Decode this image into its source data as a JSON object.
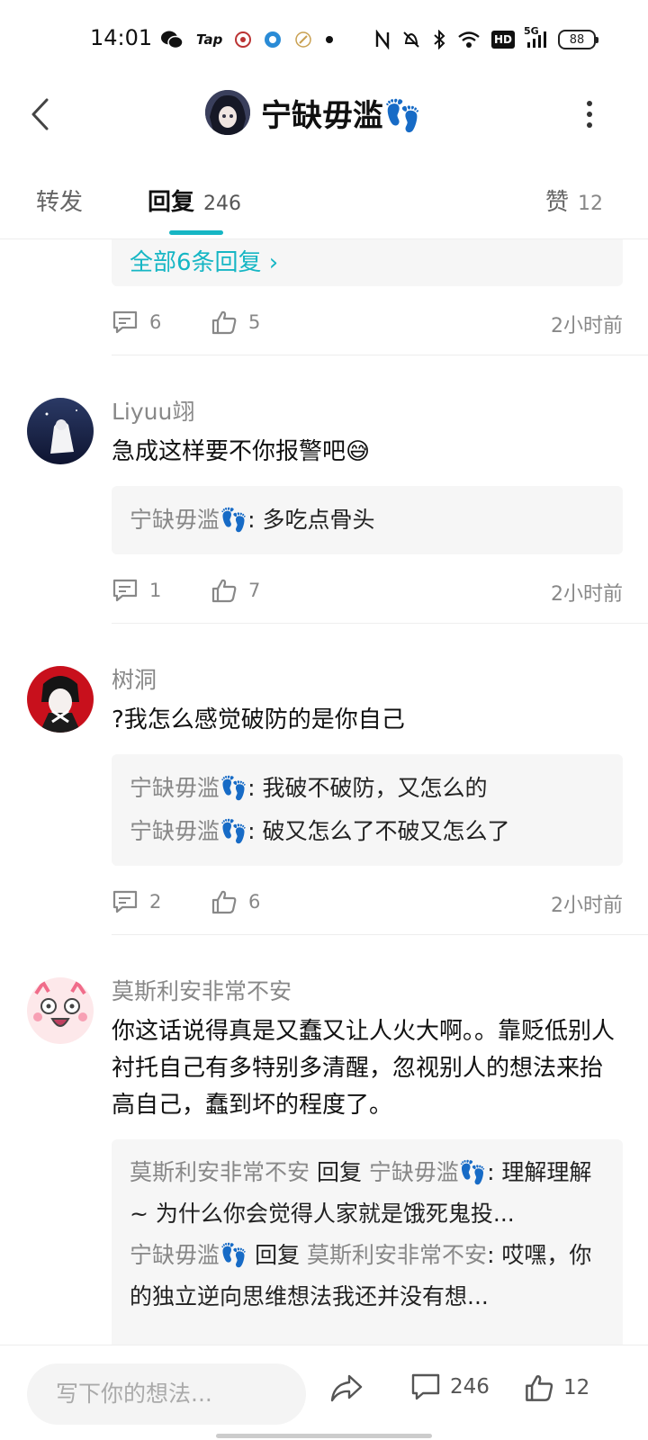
{
  "status_bar": {
    "time": "14:01",
    "icons_left": [
      "wechat-icon",
      "taptap-icon",
      "app-icon",
      "app-icon",
      "app-icon",
      "dot-icon"
    ],
    "tap_label": "Tap",
    "icons_right": [
      "nfc-icon",
      "mute-icon",
      "bluetooth-icon",
      "wifi-icon",
      "hd-icon",
      "signal-5g-icon"
    ],
    "hd_label": "HD",
    "network_label": "5G",
    "battery": "88"
  },
  "header": {
    "title": "宁缺毋滥👣"
  },
  "tabs": [
    {
      "label": "转发",
      "count": ""
    },
    {
      "label": "回复",
      "count": "246"
    },
    {
      "label": "赞",
      "count": "12"
    }
  ],
  "thread_top": {
    "all_replies": "全部6条回复 ›",
    "reply_count": "6",
    "like_count": "5",
    "time": "2小时前"
  },
  "comments": [
    {
      "username": "Liyuu翊",
      "text": "急成这样要不你报警吧😅",
      "replies": [
        {
          "user": "宁缺毋滥👣",
          "text": ": 多吃点骨头"
        }
      ],
      "reply_count": "1",
      "like_count": "7",
      "time": "2小时前"
    },
    {
      "username": "树洞",
      "text": "?我怎么感觉破防的是你自己",
      "replies": [
        {
          "user": "宁缺毋滥👣",
          "text": ": 我破不破防，又怎么的"
        },
        {
          "user": "宁缺毋滥👣",
          "text": ": 破又怎么了不破又怎么了"
        }
      ],
      "reply_count": "2",
      "like_count": "6",
      "time": "2小时前"
    },
    {
      "username": "莫斯利安非常不安",
      "text": "你这话说得真是又蠢又让人火大啊。。靠贬低别人衬托自己有多特别多清醒，忽视别人的想法来抬高自己，蠢到坏的程度了。",
      "replies": [
        {
          "user": "莫斯利安非常不安",
          "mid": " 回复 ",
          "target": "宁缺毋滥👣",
          "text": ": 理解理解 ~ 为什么你会觉得人家就是饿死鬼投..."
        },
        {
          "user": "宁缺毋滥👣",
          "mid": " 回复 ",
          "target": "莫斯利安非常不安",
          "text": ": 哎嘿，你的独立逆向思维想法我还并没有想..."
        }
      ]
    }
  ],
  "bottom_bar": {
    "input_placeholder": "写下你的想法...",
    "comment_count": "246",
    "like_count": "12"
  },
  "colors": {
    "accent": "#16b6c4",
    "muted_text": "#888888",
    "reply_bg": "#f6f6f6"
  }
}
